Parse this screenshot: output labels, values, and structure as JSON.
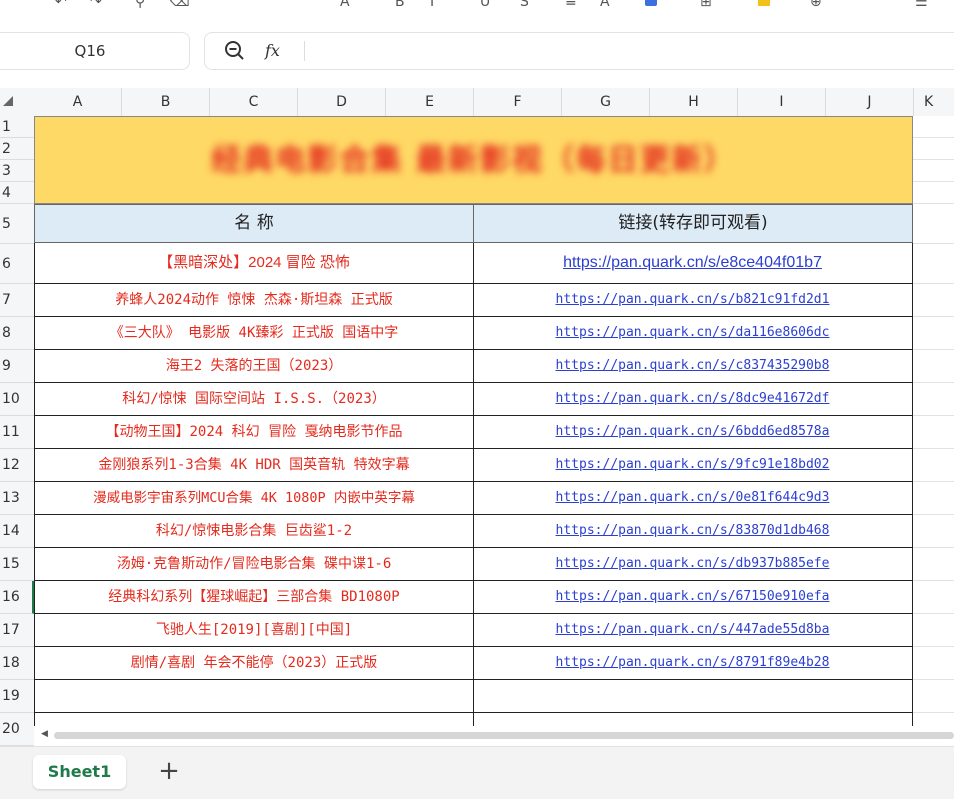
{
  "formula_bar": {
    "cell_ref": "Q16",
    "fx_label": "fx",
    "content": ""
  },
  "columns": [
    "A",
    "B",
    "C",
    "D",
    "E",
    "F",
    "G",
    "H",
    "I",
    "J",
    "K"
  ],
  "rows": [
    "1",
    "2",
    "3",
    "4",
    "5",
    "6",
    "7",
    "8",
    "9",
    "10",
    "11",
    "12",
    "13",
    "14",
    "15",
    "16",
    "17",
    "18",
    "19",
    "20"
  ],
  "active_row": "16",
  "sheet": {
    "title": "经典电影合集 最新影视（每日更新）",
    "header_name": "名 称",
    "header_link": "链接(转存即可观看)",
    "items": [
      {
        "name": "【黑暗深处】2024 冒险 恐怖",
        "link": "https://pan.quark.cn/s/e8ce404f01b7"
      },
      {
        "name": "养蜂人2024动作 惊悚 杰森·斯坦森 正式版",
        "link": "https://pan.quark.cn/s/b821c91fd2d1"
      },
      {
        "name": "《三大队》 电影版 4K臻彩 正式版 国语中字",
        "link": "https://pan.quark.cn/s/da116e8606dc"
      },
      {
        "name": "海王2 失落的王国（2023）",
        "link": "https://pan.quark.cn/s/c837435290b8"
      },
      {
        "name": "科幻/惊悚 国际空间站 I.S.S.（2023）",
        "link": "https://pan.quark.cn/s/8dc9e41672df"
      },
      {
        "name": "【动物王国】2024 科幻 冒险 戛纳电影节作品",
        "link": "https://pan.quark.cn/s/6bdd6ed8578a"
      },
      {
        "name": "金刚狼系列1-3合集 4K HDR 国英音轨 特效字幕",
        "link": "https://pan.quark.cn/s/9fc91e18bd02"
      },
      {
        "name": "漫威电影宇宙系列MCU合集 4K 1080P 内嵌中英字幕",
        "link": "https://pan.quark.cn/s/0e81f644c9d3"
      },
      {
        "name": "科幻/惊悚电影合集 巨齿鲨1-2",
        "link": "https://pan.quark.cn/s/83870d1db468"
      },
      {
        "name": "汤姆·克鲁斯动作/冒险电影合集 碟中谍1-6",
        "link": "https://pan.quark.cn/s/db937b885efe"
      },
      {
        "name": "经典科幻系列【猩球崛起】三部合集 BD1080P",
        "link": "https://pan.quark.cn/s/67150e910efa"
      },
      {
        "name": "飞驰人生[2019][喜剧][中国]",
        "link": "https://pan.quark.cn/s/447ade55d8ba"
      },
      {
        "name": "剧情/喜剧 年会不能停（2023）正式版",
        "link": "https://pan.quark.cn/s/8791f89e4b28"
      }
    ]
  },
  "tabs": {
    "sheet1": "Sheet1",
    "add": "+"
  },
  "colors": {
    "title_bg": "#ffd965",
    "title_text": "#e42b1e",
    "header_bg": "#ddebf7",
    "name_text": "#e42b1e",
    "link_text": "#2b3fd1",
    "accent": "#1f7a4a"
  }
}
